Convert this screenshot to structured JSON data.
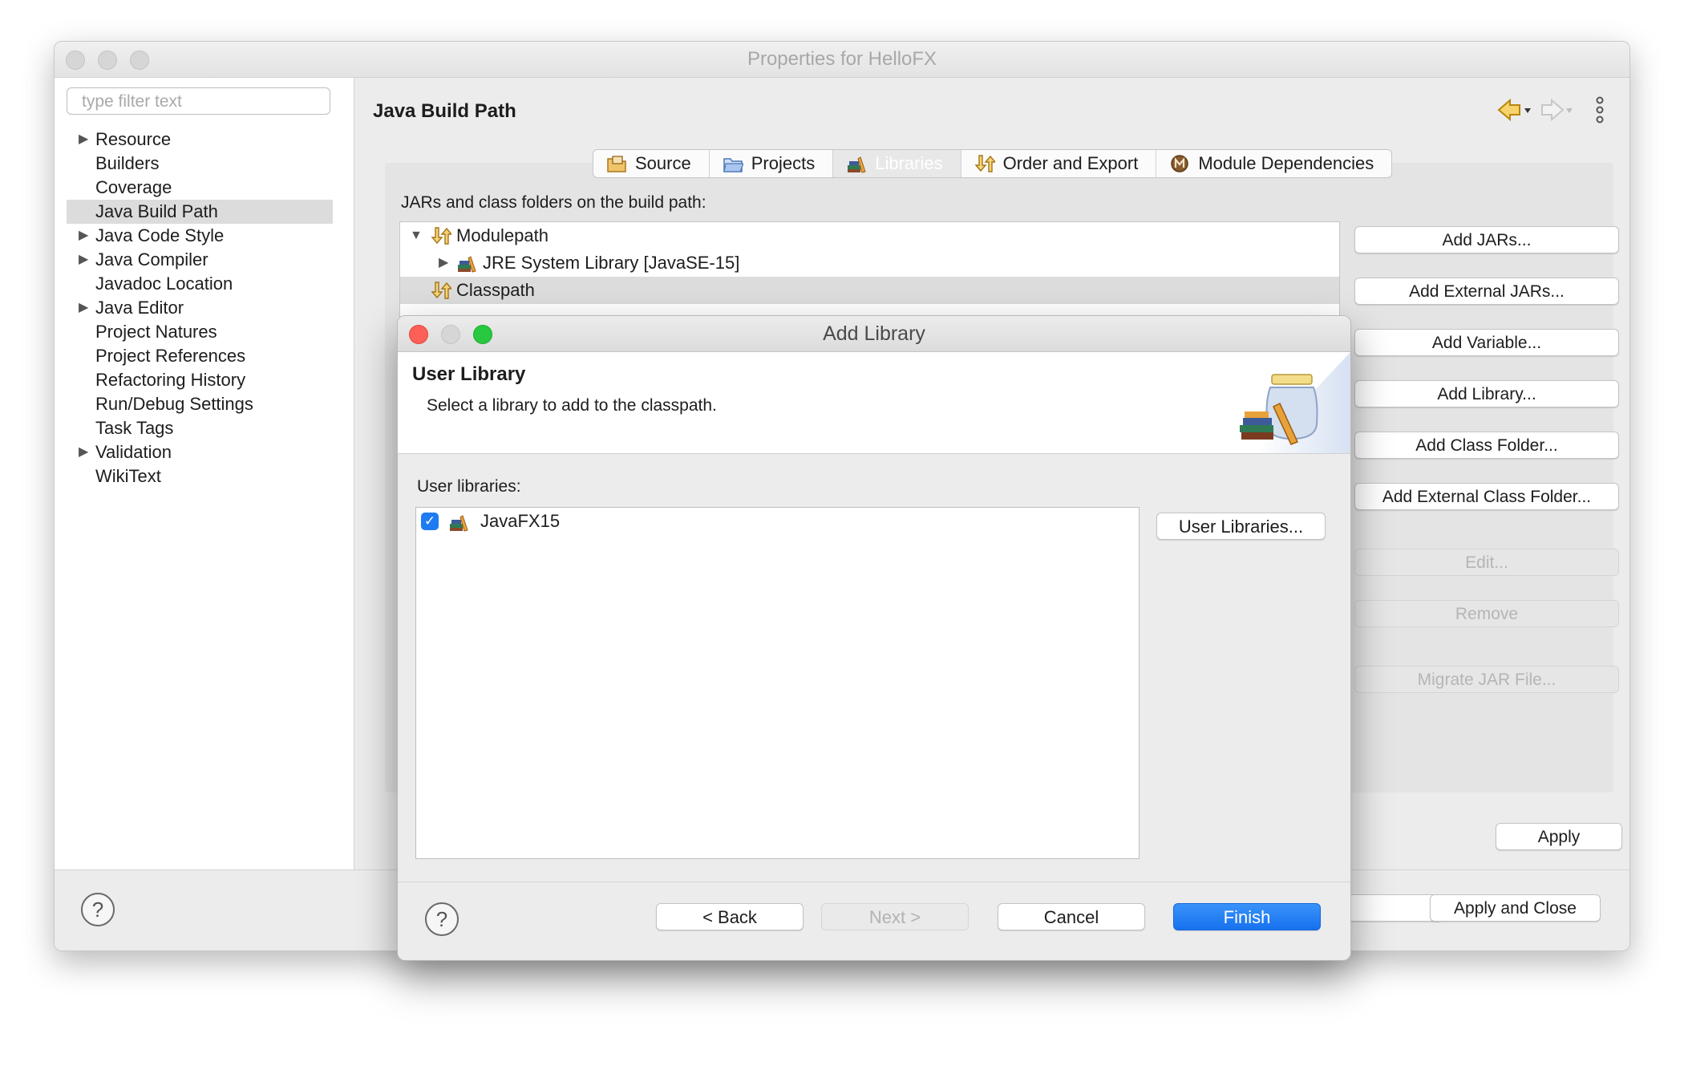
{
  "window": {
    "title": "Properties for HelloFX"
  },
  "nav": {
    "filter_placeholder": "type filter text",
    "items": [
      {
        "label": "Resource",
        "expandable": true
      },
      {
        "label": "Builders",
        "expandable": false
      },
      {
        "label": "Coverage",
        "expandable": false
      },
      {
        "label": "Java Build Path",
        "expandable": false,
        "selected": true
      },
      {
        "label": "Java Code Style",
        "expandable": true
      },
      {
        "label": "Java Compiler",
        "expandable": true
      },
      {
        "label": "Javadoc Location",
        "expandable": false
      },
      {
        "label": "Java Editor",
        "expandable": true
      },
      {
        "label": "Project Natures",
        "expandable": false
      },
      {
        "label": "Project References",
        "expandable": false
      },
      {
        "label": "Refactoring History",
        "expandable": false
      },
      {
        "label": "Run/Debug Settings",
        "expandable": false
      },
      {
        "label": "Task Tags",
        "expandable": false
      },
      {
        "label": "Validation",
        "expandable": true
      },
      {
        "label": "WikiText",
        "expandable": false
      }
    ]
  },
  "page": {
    "title": "Java Build Path",
    "tabs": [
      {
        "label": "Source",
        "icon": "source-folder-icon"
      },
      {
        "label": "Projects",
        "icon": "projects-folder-icon"
      },
      {
        "label": "Libraries",
        "icon": "libraries-icon",
        "active": true
      },
      {
        "label": "Order and Export",
        "icon": "order-export-icon"
      },
      {
        "label": "Module Dependencies",
        "icon": "module-icon"
      }
    ],
    "jars_label": "JARs and class folders on the build path:",
    "tree": [
      {
        "label": "Modulepath",
        "icon": "modulepath-icon",
        "expanded": true
      },
      {
        "label": "JRE System Library [JavaSE-15]",
        "icon": "library-icon",
        "expanded": false
      },
      {
        "label": "Classpath",
        "icon": "classpath-icon",
        "selected": true
      }
    ],
    "buttons": [
      {
        "label": "Add JARs...",
        "enabled": true
      },
      {
        "label": "Add External JARs...",
        "enabled": true
      },
      {
        "label": "Add Variable...",
        "enabled": true
      },
      {
        "label": "Add Library...",
        "enabled": true
      },
      {
        "label": "Add Class Folder...",
        "enabled": true
      },
      {
        "label": "Add External Class Folder...",
        "enabled": true
      },
      {
        "label": "Edit...",
        "enabled": false
      },
      {
        "label": "Remove",
        "enabled": false
      },
      {
        "label": "Migrate JAR File...",
        "enabled": false
      }
    ],
    "apply_label": "Apply",
    "apply_close_label": "Apply and Close"
  },
  "dialog": {
    "title": "Add Library",
    "banner_title": "User Library",
    "banner_desc": "Select a library to add to the classpath.",
    "list_label": "User libraries:",
    "libraries": [
      {
        "label": "JavaFX15",
        "checked": true
      }
    ],
    "user_libraries_button": "User Libraries...",
    "back_button": "< Back",
    "next_button": "Next >",
    "cancel_button": "Cancel",
    "finish_button": "Finish"
  },
  "colors": {
    "accent": "#1e7bf2",
    "window_bg": "#ececec",
    "close_light": "#fe5f57",
    "minimize_light": "#d0d0d0",
    "zoom_light": "#28c840"
  }
}
